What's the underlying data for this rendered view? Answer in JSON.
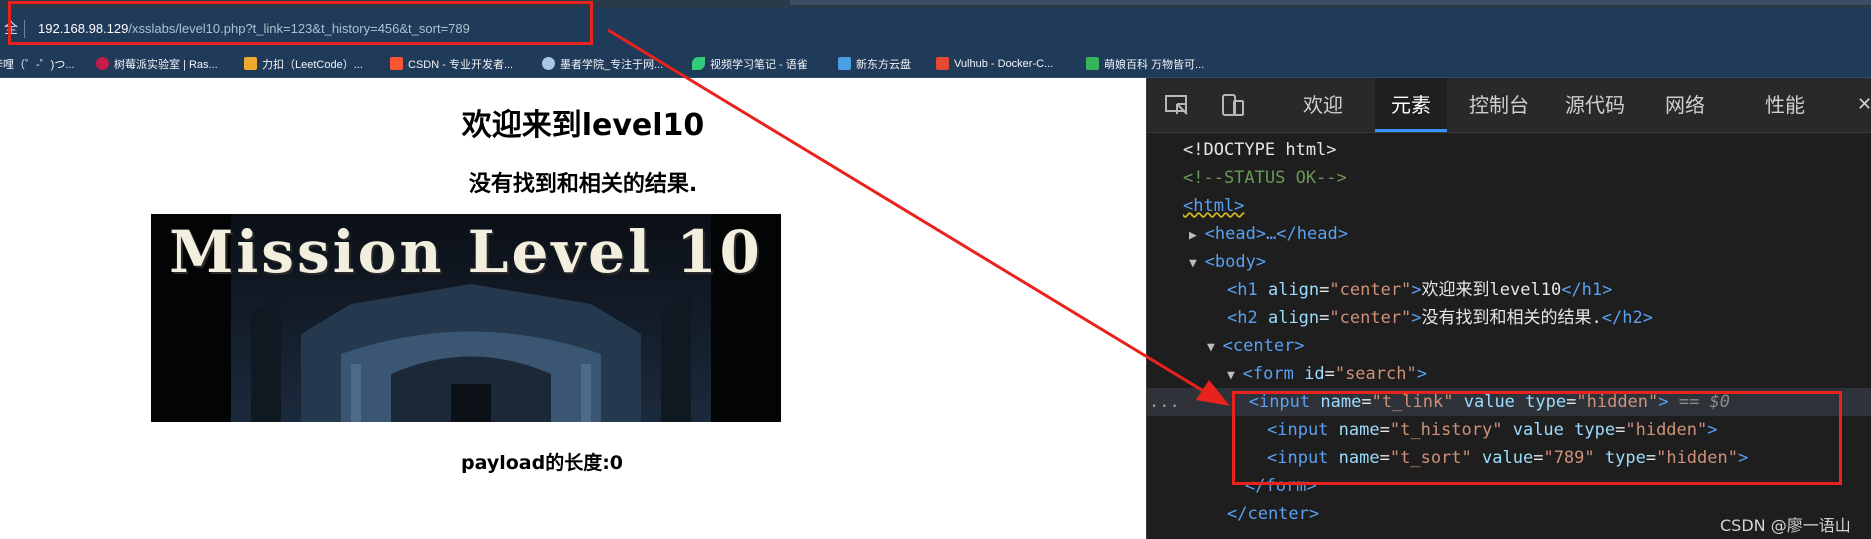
{
  "address_bar": {
    "left_glyph": "全",
    "url_host": "192.168.98.129",
    "url_path": "/xsslabs/level10.php?t_link=123&t_history=456&t_sort=789"
  },
  "bookmarks": [
    {
      "label": "哔哩（゜-゜)つ...",
      "icon": "bilibili-icon",
      "color": "#fb7299"
    },
    {
      "label": "树莓派实验室 | Ras...",
      "icon": "raspberry-icon",
      "color": "#c51a4a"
    },
    {
      "label": "力扣（LeetCode）...",
      "icon": "leetcode-icon",
      "color": "#f0a92f"
    },
    {
      "label": "CSDN - 专业开发者...",
      "icon": "csdn-icon",
      "color": "#fc5531"
    },
    {
      "label": "墨者学院_专注于网...",
      "icon": "cloud-icon",
      "color": "#a7c6e8"
    },
    {
      "label": "视频学习笔记 - 语雀",
      "icon": "yuque-icon",
      "color": "#31cc79"
    },
    {
      "label": "新东方云盘",
      "icon": "cube-icon",
      "color": "#4aa0e6"
    },
    {
      "label": "Vulhub - Docker-C...",
      "icon": "vulhub-icon",
      "color": "#e24a33"
    },
    {
      "label": "萌娘百科 万物皆可...",
      "icon": "moegirl-icon",
      "color": "#35b45a"
    }
  ],
  "page": {
    "heading": "欢迎来到level10",
    "subheading": "没有找到和相关的结果.",
    "banner_text": "Mission Level 10",
    "payload_label": "payload的长度:0"
  },
  "devtools": {
    "tabs": [
      {
        "label": "欢迎",
        "active": false
      },
      {
        "label": "元素",
        "active": true
      },
      {
        "label": "控制台",
        "active": false
      },
      {
        "label": "源代码",
        "active": false
      },
      {
        "label": "网络",
        "active": false
      },
      {
        "label": "性能",
        "active": false
      }
    ],
    "close_glyph": "✕",
    "code": {
      "doctype": "<!DOCTYPE html>",
      "comment": "<!--STATUS OK-->",
      "html_tag": "<html>",
      "head": "<head>…</head>",
      "body_open": "<body>",
      "h1_open": "<h1",
      "h1_attr": "align",
      "h1_val": "\"center\"",
      "h1_text": "欢迎来到level10",
      "h1_close": "</h1>",
      "h2_open": "<h2",
      "h2_attr": "align",
      "h2_val": "\"center\"",
      "h2_text": "没有找到和相关的结果.",
      "h2_close": "</h2>",
      "center_open": "<center>",
      "form_open": "<form",
      "form_attr": "id",
      "form_val": "\"search\"",
      "input": "<input",
      "name_attr": "name",
      "t_link": "\"t_link\"",
      "t_history": "\"t_history\"",
      "t_sort": "\"t_sort\"",
      "value_attr": "value",
      "value_789": "\"789\"",
      "type_attr": "type",
      "hidden": "\"hidden\"",
      "eq_dollar": "== $0",
      "selection_dots": "...",
      "form_close": "</form>",
      "center_close": "</center>"
    }
  },
  "watermark": "CSDN @廖一语山",
  "colors": {
    "highlight": "#e8231e",
    "accent": "#3794ff"
  }
}
